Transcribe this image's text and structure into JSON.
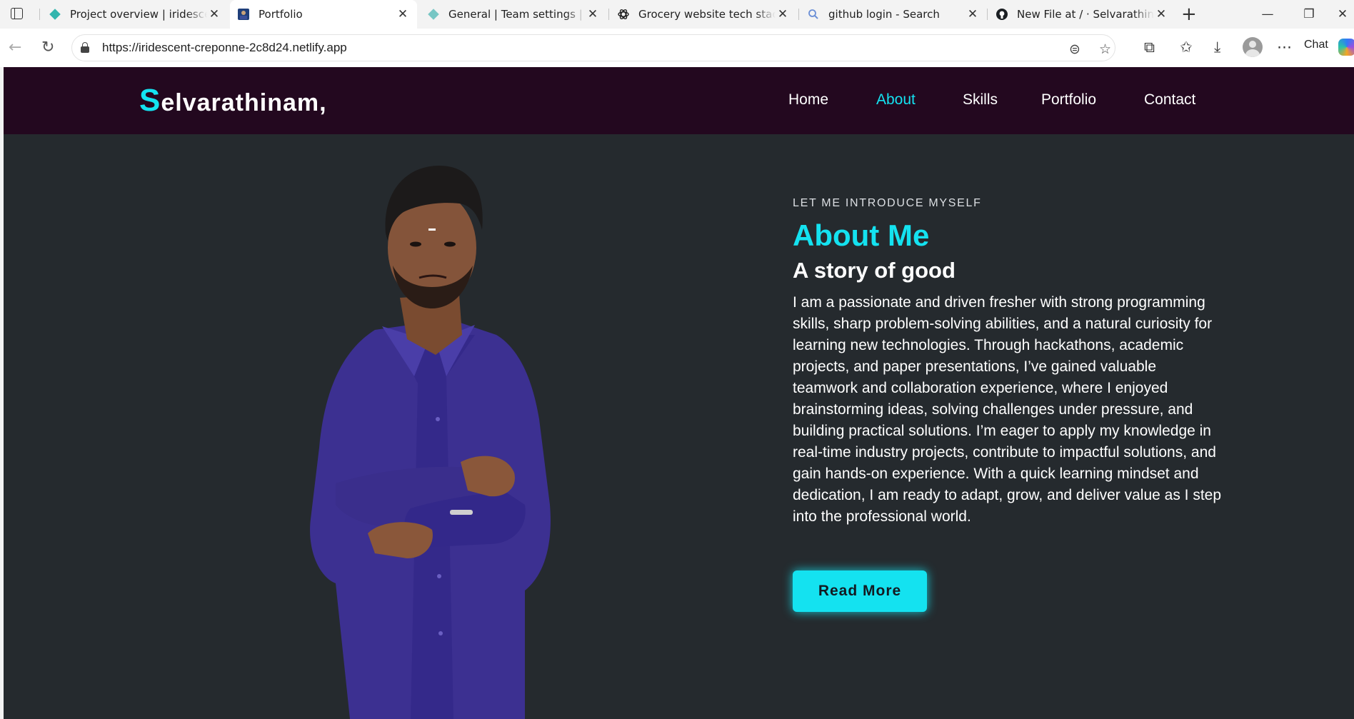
{
  "browser": {
    "tabs": [
      {
        "title": "Project overview | iridescent-",
        "favicon": "netlify-diamond-icon"
      },
      {
        "title": "Portfolio",
        "favicon": "portfolio-icon",
        "active": true
      },
      {
        "title": "General | Team settings | selv",
        "favicon": "netlify-diamond-icon"
      },
      {
        "title": "Grocery website tech stack",
        "favicon": "chatgpt-icon"
      },
      {
        "title": "github login - Search",
        "favicon": "search-icon"
      },
      {
        "title": "New File at / · Selvarathinam",
        "favicon": "github-icon"
      }
    ],
    "url": "https://iridescent-creponne-2c8d24.netlify.app",
    "chat_label": "Chat"
  },
  "site": {
    "logo_initial": "S",
    "logo_rest": "elvarathinam,",
    "nav": [
      "Home",
      "About",
      "Skills",
      "Portfolio",
      "Contact"
    ],
    "active_nav": "About"
  },
  "about": {
    "intro": "LET ME INTRODUCE MYSELF",
    "heading": "About Me",
    "subheading": "A story of good",
    "body": "I am a passionate and driven fresher with strong programming skills, sharp problem-solving abilities, and a natural curiosity for learning new technologies. Through hackathons, academic projects, and paper presentations, I’ve gained valuable teamwork and collaboration experience, where I enjoyed brainstorming ideas, solving challenges under pressure, and building practical solutions. I’m eager to apply my knowledge in real-time industry projects, contribute to impactful solutions, and gain hands-on experience. With a quick learning mindset and dedication, I am ready to adapt, grow, and deliver value as I step into the professional world.",
    "button": "Read More"
  },
  "colors": {
    "accent": "#14e2f0",
    "header_bg": "#23081f",
    "page_bg": "#252a2e",
    "shirt": "#3c3091"
  }
}
